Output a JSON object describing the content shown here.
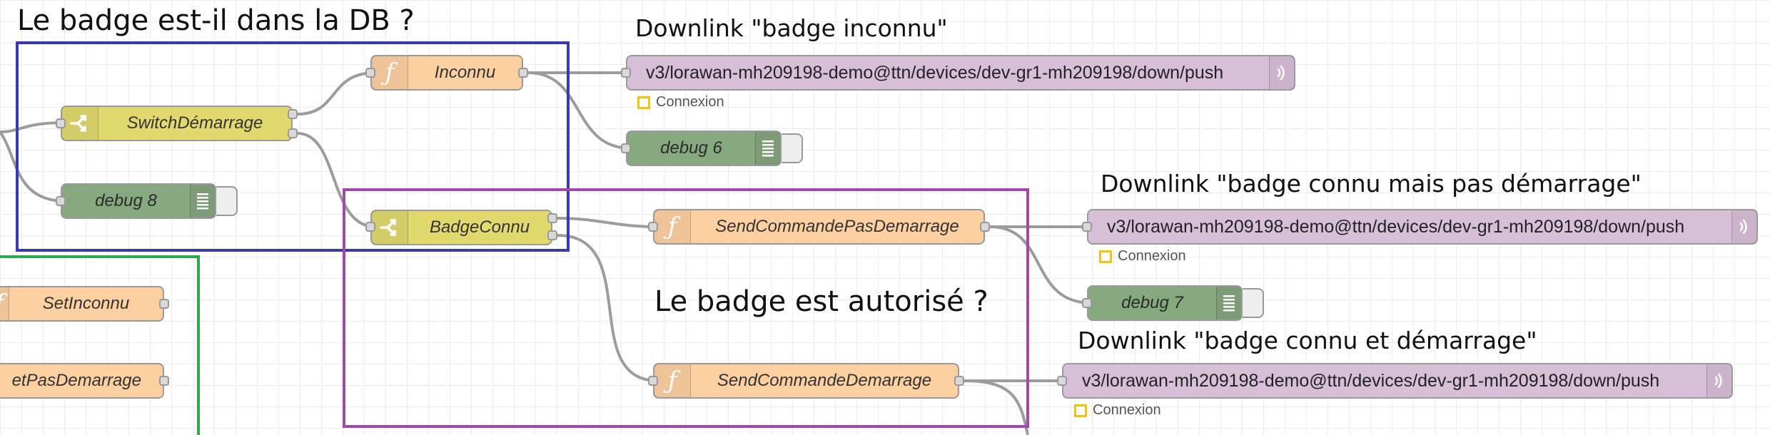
{
  "annotations": {
    "db_question": "Le badge est-il dans la DB ?",
    "downlink_unknown": "Downlink \"badge inconnu\"",
    "downlink_known_no_start": "Downlink \"badge connu mais pas démarrage\"",
    "authorized_question": "Le badge est autorisé ?",
    "downlink_known_start": "Downlink \"badge connu et démarrage\""
  },
  "colors": {
    "group_blue": "#3a3ab0",
    "group_purple": "#a04aa8",
    "group_green": "#2ea84f",
    "wire": "#9c9c9c",
    "function_node": "#fdd0a2",
    "switch_node": "#e2d96e",
    "debug_node": "#87a980",
    "mqtt_node": "#d8bfd8",
    "status_connecting": "#f1c40f"
  },
  "nodes": {
    "switch_demarrage": "SwitchDémarrage",
    "inconnu": "Inconnu",
    "badge_connu": "BadgeConnu",
    "send_pas_demarrage": "SendCommandePasDemarrage",
    "send_demarrage": "SendCommandeDemarrage",
    "set_inconnu": "SetInconnu",
    "set_pas_demarrage_partial": "etPasDemarrage",
    "debug6": "debug 6",
    "debug7": "debug 7",
    "debug8": "debug 8",
    "mqtt_topic_1": "v3/lorawan-mh209198-demo@ttn/devices/dev-gr1-mh209198/down/push",
    "mqtt_topic_2": "v3/lorawan-mh209198-demo@ttn/devices/dev-gr1-mh209198/down/push",
    "mqtt_topic_3": "v3/lorawan-mh209198-demo@ttn/devices/dev-gr1-mh209198/down/push",
    "status_1": "Connexion",
    "status_2": "Connexion",
    "status_3": "Connexion"
  },
  "icons": {
    "function": "function-icon",
    "switch": "switch-icon",
    "debug": "debug-list-icon",
    "mqtt": "radio-waves-icon",
    "status": "status-square-icon"
  }
}
